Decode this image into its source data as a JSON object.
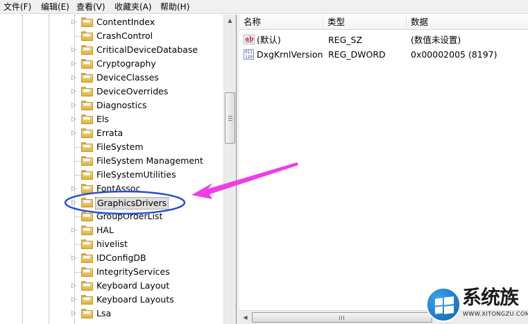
{
  "menu": [
    "文件(F)",
    "编辑(E)",
    "查看(V)",
    "收藏夹(A)",
    "帮助(H)"
  ],
  "tree": [
    {
      "label": "ContentIndex",
      "expandable": true
    },
    {
      "label": "CrashControl",
      "expandable": false
    },
    {
      "label": "CriticalDeviceDatabase",
      "expandable": true
    },
    {
      "label": "Cryptography",
      "expandable": true
    },
    {
      "label": "DeviceClasses",
      "expandable": true
    },
    {
      "label": "DeviceOverrides",
      "expandable": true
    },
    {
      "label": "Diagnostics",
      "expandable": true
    },
    {
      "label": "Els",
      "expandable": true
    },
    {
      "label": "Errata",
      "expandable": true
    },
    {
      "label": "FileSystem",
      "expandable": false
    },
    {
      "label": "FileSystem Management",
      "expandable": false
    },
    {
      "label": "FileSystemUtilities",
      "expandable": false
    },
    {
      "label": "FontAssoc",
      "expandable": true
    },
    {
      "label": "GraphicsDrivers",
      "expandable": true,
      "selected": true
    },
    {
      "label": "GroupOrderList",
      "expandable": false
    },
    {
      "label": "HAL",
      "expandable": true
    },
    {
      "label": "hivelist",
      "expandable": false
    },
    {
      "label": "IDConfigDB",
      "expandable": true
    },
    {
      "label": "IntegrityServices",
      "expandable": false
    },
    {
      "label": "Keyboard Layout",
      "expandable": true
    },
    {
      "label": "Keyboard Layouts",
      "expandable": true
    },
    {
      "label": "Lsa",
      "expandable": true
    }
  ],
  "columns": {
    "name": "名称",
    "type": "类型",
    "data": "数据"
  },
  "values": [
    {
      "icon": "string-value-icon",
      "name": "(默认)",
      "type": "REG_SZ",
      "data": "(数值未设置)"
    },
    {
      "icon": "binary-value-icon",
      "name": "DxgKrnlVersion",
      "type": "REG_DWORD",
      "data": "0x00002005 (8197)"
    }
  ],
  "watermark": {
    "brand": "系统族",
    "url": "WWW.XITONGZU.COM"
  },
  "colors": {
    "annotation_arrow": "#ee3ee8",
    "annotation_circle": "#2a4ecf"
  }
}
